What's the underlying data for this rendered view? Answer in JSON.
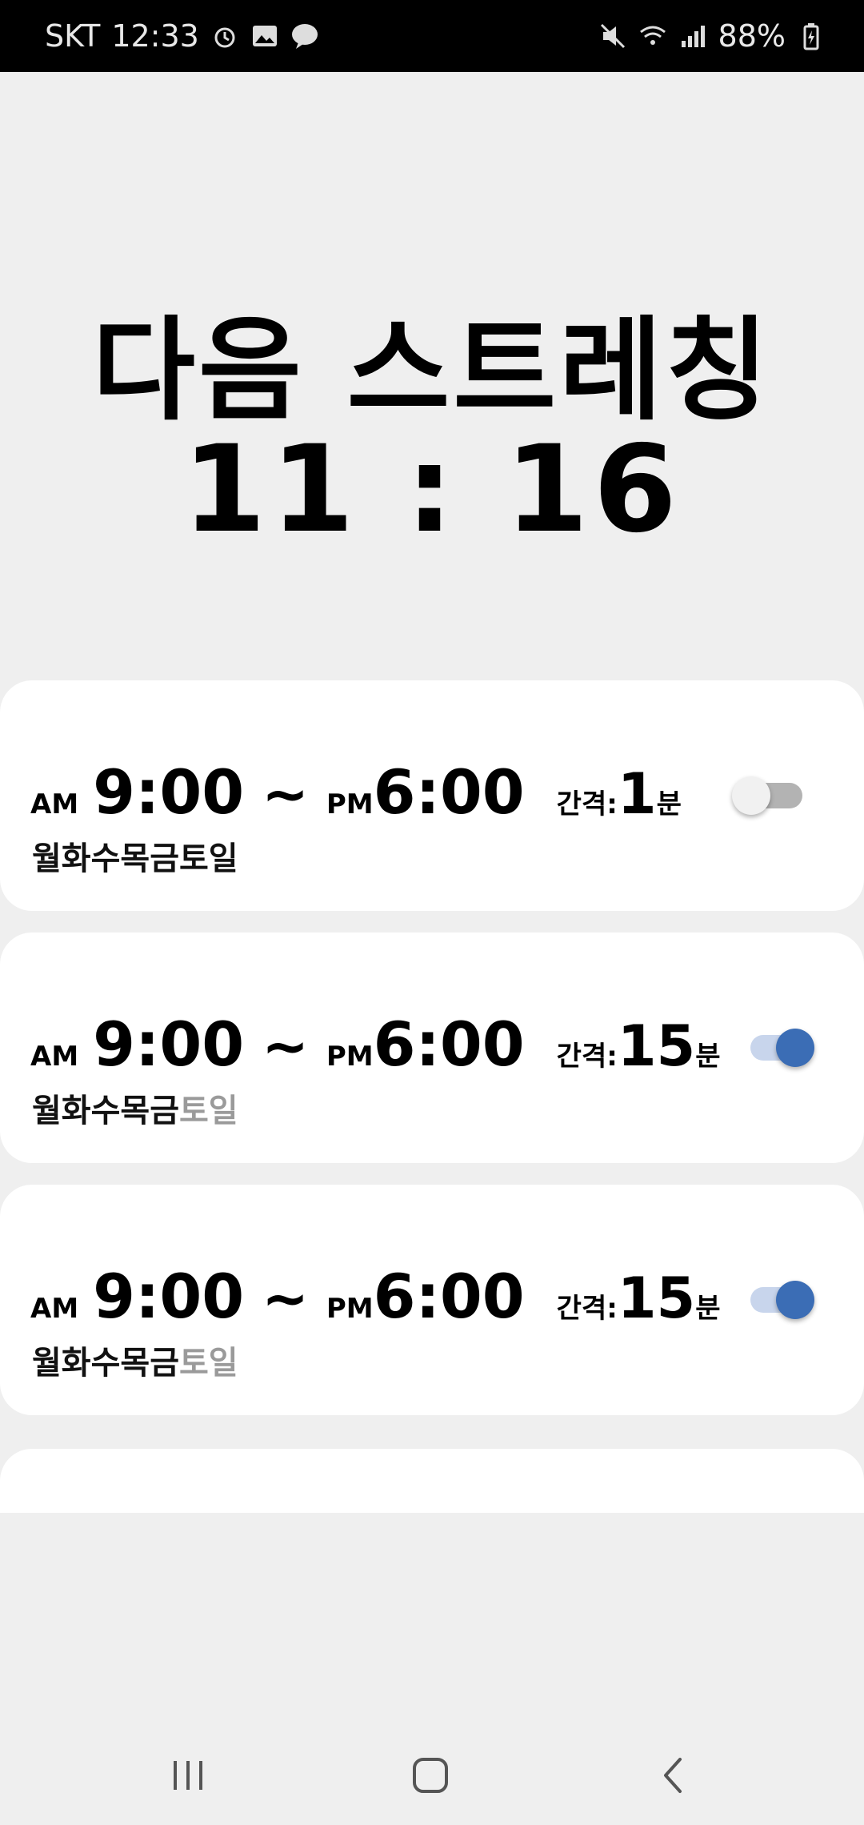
{
  "status": {
    "carrier": "SKT",
    "time": "12:33",
    "battery": "88%",
    "left_icons": [
      "alarm-icon",
      "image-icon",
      "talk-icon"
    ],
    "right_icons": [
      "mute-icon",
      "wifi-icon",
      "signal-icon",
      "battery-icon"
    ]
  },
  "header": {
    "title": "다음 스트레칭",
    "countdown": "11 : 16"
  },
  "schedules": [
    {
      "start_ampm": "AM",
      "start_time": "9:00",
      "tilde": "~",
      "end_ampm": "PM",
      "end_time": "6:00",
      "interval_label": "간격:",
      "interval_value": "1",
      "interval_unit": "분",
      "days_on": "월화수목금토일",
      "days_off": "",
      "enabled": false
    },
    {
      "start_ampm": "AM",
      "start_time": "9:00",
      "tilde": "~",
      "end_ampm": "PM",
      "end_time": "6:00",
      "interval_label": "간격:",
      "interval_value": "15",
      "interval_unit": "분",
      "days_on": "월화수목금",
      "days_off": "토일",
      "enabled": true
    },
    {
      "start_ampm": "AM",
      "start_time": "9:00",
      "tilde": "~",
      "end_ampm": "PM",
      "end_time": "6:00",
      "interval_label": "간격:",
      "interval_value": "15",
      "interval_unit": "분",
      "days_on": "월화수목금",
      "days_off": "토일",
      "enabled": true
    }
  ],
  "colors": {
    "accent": "#3b6db5",
    "background": "#efefef",
    "inactive_day": "#9a9a9a"
  },
  "nav": {
    "items": [
      "recent-apps-icon",
      "home-icon",
      "back-icon"
    ]
  }
}
